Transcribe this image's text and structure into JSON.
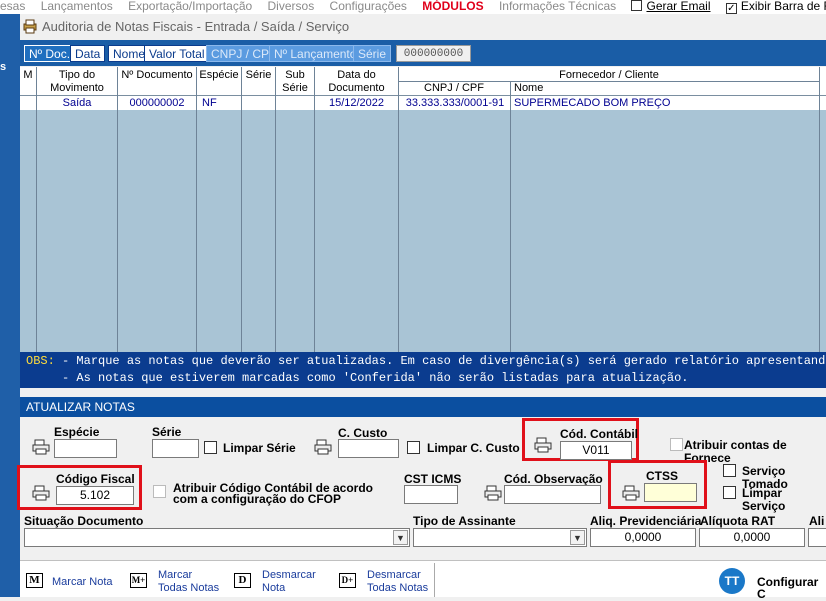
{
  "menu": {
    "items": [
      "esas",
      "Lançamentos",
      "Exportação/Importação",
      "Diversos",
      "Configurações"
    ],
    "modulos": "MÓDULOS",
    "info": "Informações Técnicas",
    "gerar_email": "Gerar Email",
    "exibir_barra": "Exibir Barra de Ferramen",
    "gerar_email_checked": false,
    "exibir_barra_checked": true
  },
  "leftstrip": {
    "label": "s"
  },
  "window": {
    "title": "Auditoria de Notas Fiscais   -   Entrada / Saída / Serviço"
  },
  "tabs": {
    "ndoc": "Nº Doc.",
    "data": "Data",
    "nome": "Nome",
    "valor_total": "Valor Total",
    "cnpj": "CNPJ / CPF",
    "lancamento": "Nº Lançamento",
    "serie": "Série",
    "number_field": "000000000"
  },
  "grid": {
    "headers": {
      "m": "M",
      "tipo_l1": "Tipo do",
      "tipo_l2": "Movimento",
      "ndoc": "Nº Documento",
      "especie": "Espécie",
      "serie": "Série",
      "sub_l1": "Sub",
      "sub_l2": "Série",
      "data_l1": "Data do",
      "data_l2": "Documento",
      "fornecedor": "Fornecedor / Cliente",
      "cnpj": "CNPJ / CPF",
      "nome": "Nome"
    },
    "rows": [
      {
        "tipo": "Saída",
        "ndoc": "000000002",
        "especie": "NF",
        "serie": "",
        "sub": "",
        "data": "15/12/2022",
        "cnpj": "33.333.333/0001-91",
        "nome": "SUPERMECADO BOM PREÇO"
      }
    ]
  },
  "obs": {
    "label": "OBS:",
    "line1": " - Marque as notas que deverão ser atualizadas. Em caso de divergência(s) será gerado relatório apresentando a",
    "line2": "     - As notas que estiverem marcadas como 'Conferida' não serão listadas para atualização."
  },
  "atualizar": {
    "header": "ATUALIZAR NOTAS",
    "especie_label": "Espécie",
    "especie_value": "",
    "serie_label": "Série",
    "serie_value": "",
    "limpar_serie": "Limpar Série",
    "ccusto_label": "C. Custo",
    "ccusto_value": "",
    "limpar_ccusto": "Limpar C. Custo",
    "cod_contabil_label": "Cód. Contábil",
    "cod_contabil_value": "V011",
    "atribuir_contas": "Atribuir contas de Fornece",
    "codigo_fiscal_label": "Código Fiscal",
    "codigo_fiscal_value": "5.102",
    "atribuir_cod_l1": "Atribuir Código Contábil de acordo",
    "atribuir_cod_l2": "com a configuração do CFOP",
    "cst_icms_label": "CST ICMS",
    "cst_icms_value": "",
    "cod_obs_label": "Cód. Observação",
    "cod_obs_value": "",
    "ctss_label": "CTSS",
    "ctss_value": "",
    "servico_tomado": "Serviço Tomado",
    "limpar_servico": "Limpar Serviço",
    "situacao_label": "Situação Documento",
    "situacao_value": "",
    "tipo_assinante_label": "Tipo de Assinante",
    "tipo_assinante_value": "",
    "aliq_prev_label": "Aliq. Previdenciária",
    "aliq_prev_value": "0,0000",
    "aliq_rat_label": "Alíquota RAT",
    "aliq_rat_value": "0,0000",
    "ali_label": "Ali"
  },
  "bottom": {
    "marcar_nota_icon": "M",
    "marcar_nota": "Marcar Nota",
    "marcar_todas_icon": "M+",
    "marcar_todas_l1": "Marcar",
    "marcar_todas_l2": "Todas Notas",
    "desmarcar_nota_icon": "D",
    "desmarcar_nota_l1": "Desmarcar",
    "desmarcar_nota_l2": "Nota",
    "desmarcar_todas_icon": "D+",
    "desmarcar_todas_l1": "Desmarcar",
    "desmarcar_todas_l2": "Todas Notas",
    "configurar_icon": "TT",
    "configurar": "Configurar C"
  },
  "colors": {
    "blue_bar": "#0b4fa0",
    "grid_bg": "#a9c4d5",
    "highlight_red": "#e0101a",
    "obs_yellow": "#ffdc3c"
  }
}
